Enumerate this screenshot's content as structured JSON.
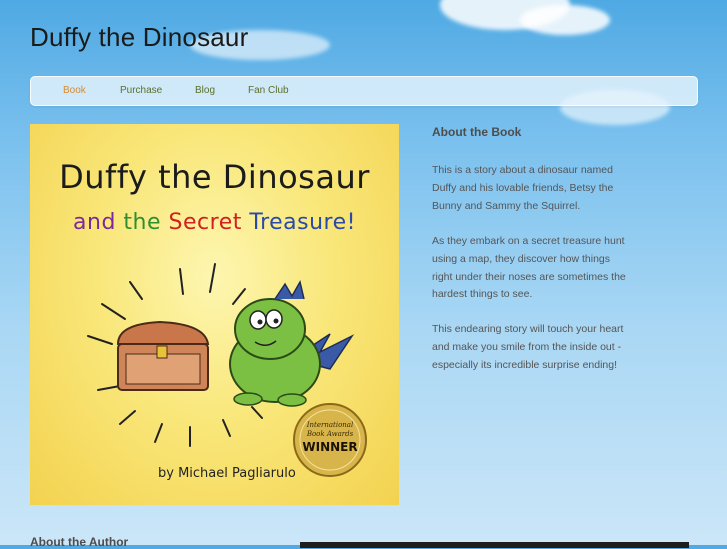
{
  "site": {
    "title": "Duffy the Dinosaur"
  },
  "nav": {
    "items": [
      {
        "label": "Book",
        "active": true
      },
      {
        "label": "Purchase",
        "active": false
      },
      {
        "label": "Blog",
        "active": false
      },
      {
        "label": "Fan Club",
        "active": false
      }
    ]
  },
  "cover": {
    "title": "Duffy the Dinosaur",
    "subtitle_words": [
      "and",
      "the",
      "Secret",
      "Treasure!"
    ],
    "subtitle_colors": [
      "#7a2a9a",
      "#2f8f2f",
      "#d02020",
      "#2a4aa8"
    ],
    "author": "by Michael Pagliarulo",
    "award_seal": {
      "top": "International",
      "middle": "Book Awards",
      "main": "WINNER"
    }
  },
  "about_book": {
    "heading": "About the Book",
    "paragraphs": [
      "This is a story about a dinosaur named Duffy and his lovable friends, Betsy the Bunny and Sammy the Squirrel.",
      "As they embark on a secret treasure hunt using a map, they discover how things right under their noses are sometimes the hardest things to see.",
      "This endearing story will touch your heart and make you smile from the inside out - especially its incredible surprise ending!"
    ]
  },
  "about_author": {
    "heading": "About the Author"
  },
  "colors": {
    "nav_active": "#d98a2b",
    "nav_link": "#5a6e2a",
    "dino_green": "#7cc043"
  }
}
